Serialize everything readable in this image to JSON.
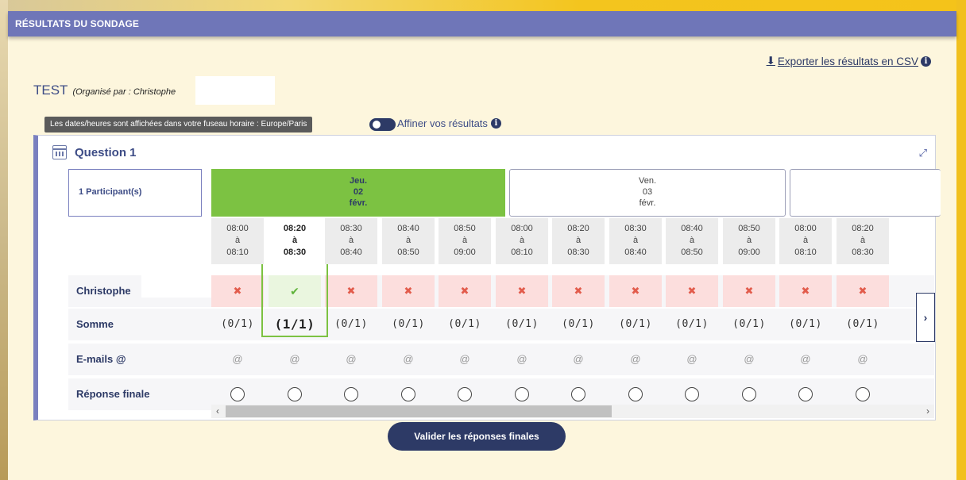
{
  "header": {
    "title": "RÉSULTATS DU SONDAGE"
  },
  "export": {
    "label": "Exporter les résultats en CSV"
  },
  "poll": {
    "title": "TEST",
    "organizer": "(Organisé par : Christophe"
  },
  "timezone": {
    "text": "Les dates/heures sont affichées dans votre fuseau horaire : Europe/Paris"
  },
  "refine": {
    "label": "Affiner vos résultats"
  },
  "question": {
    "title": "Question 1",
    "participants": "1 Participant(s)",
    "days": [
      {
        "dow": "Jeu.",
        "day": "02",
        "month": "févr.",
        "selected": true
      },
      {
        "dow": "Ven.",
        "day": "03",
        "month": "févr.",
        "selected": false
      }
    ],
    "slots": [
      {
        "start": "08:00",
        "sep": "à",
        "end": "08:10"
      },
      {
        "start": "08:20",
        "sep": "à",
        "end": "08:30"
      },
      {
        "start": "08:30",
        "sep": "à",
        "end": "08:40"
      },
      {
        "start": "08:40",
        "sep": "à",
        "end": "08:50"
      },
      {
        "start": "08:50",
        "sep": "à",
        "end": "09:00"
      },
      {
        "start": "08:00",
        "sep": "à",
        "end": "08:10"
      },
      {
        "start": "08:20",
        "sep": "à",
        "end": "08:30"
      },
      {
        "start": "08:30",
        "sep": "à",
        "end": "08:40"
      },
      {
        "start": "08:40",
        "sep": "à",
        "end": "08:50"
      },
      {
        "start": "08:50",
        "sep": "à",
        "end": "09:00"
      },
      {
        "start": "08:00",
        "sep": "à",
        "end": "08:10"
      },
      {
        "start": "08:20",
        "sep": "à",
        "end": "08:30"
      }
    ],
    "rows": {
      "participant": "Christophe",
      "sum_label": "Somme",
      "emails_label": "E-mails @",
      "final_label": "Réponse finale"
    },
    "sums": [
      "(0/1)",
      "(1/1)",
      "(0/1)",
      "(0/1)",
      "(0/1)",
      "(0/1)",
      "(0/1)",
      "(0/1)",
      "(0/1)",
      "(0/1)",
      "(0/1)",
      "(0/1)"
    ],
    "email_symbol": "@",
    "yes_mark": "✔",
    "no_mark": "✖"
  },
  "validate": {
    "label": "Valider les réponses finales"
  },
  "colors": {
    "accent": "#2d3a66",
    "header": "#6f76b8",
    "selected": "#7cc242",
    "no": "#fcdedd"
  }
}
